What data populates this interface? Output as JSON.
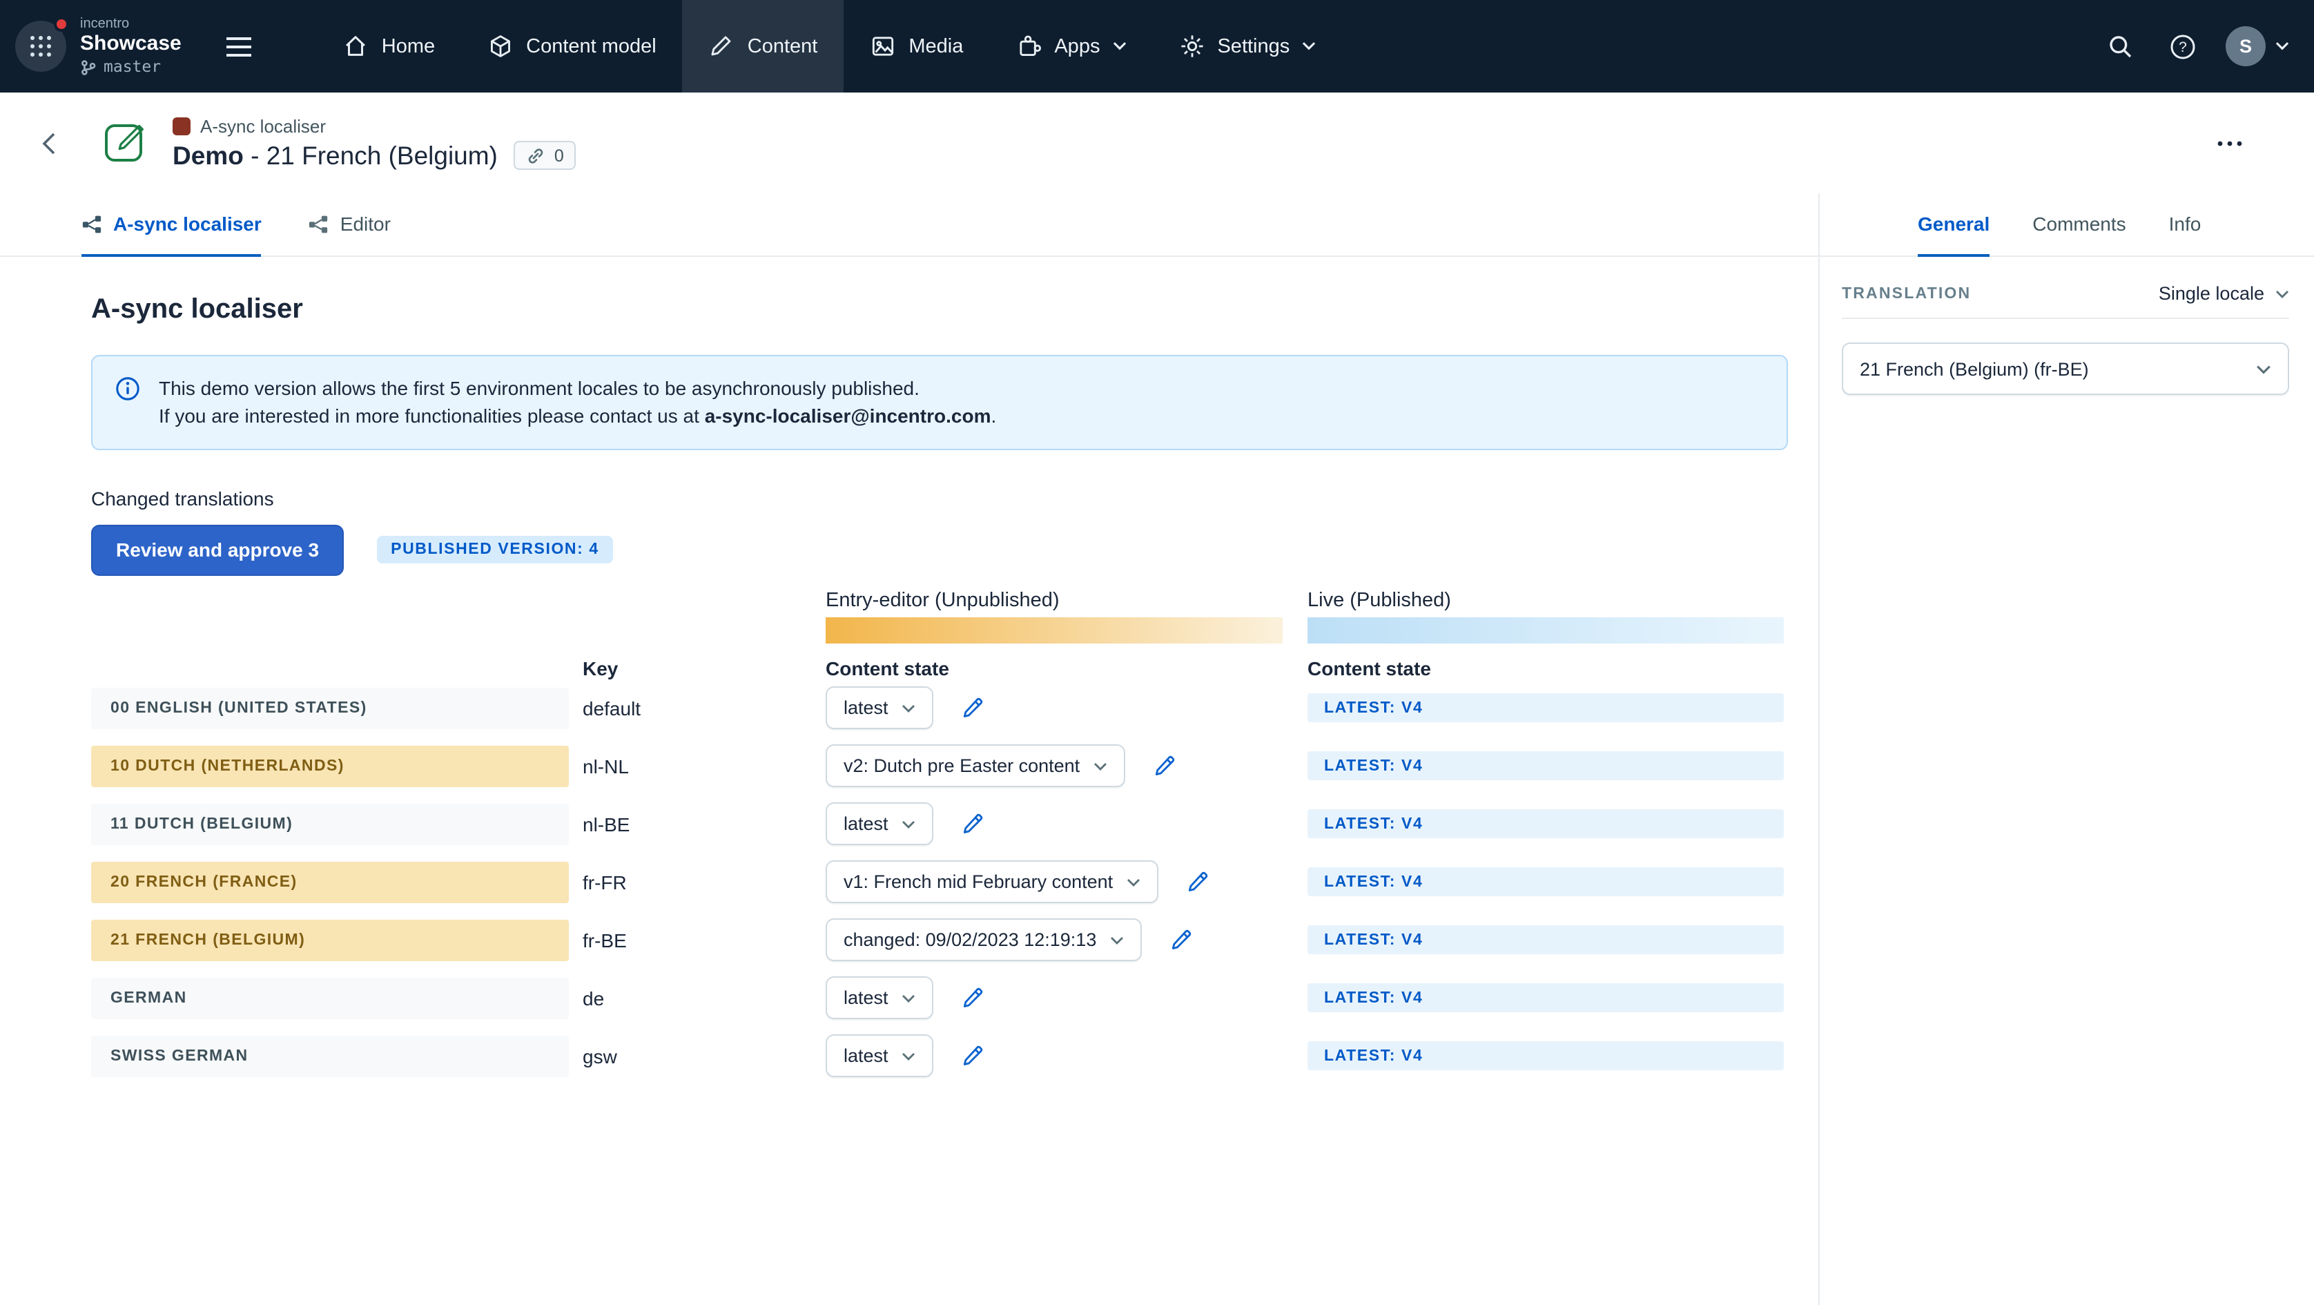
{
  "colors": {
    "nav_bg": "#0E1E2F",
    "accent_blue": "#0059C8",
    "button_blue": "#2D64C9",
    "warn_row_bg": "#F9E4B4",
    "note_bg": "#E8F5FF",
    "live_badge_bg": "#E7F3FC"
  },
  "topnav": {
    "org_label": "incentro",
    "space_name": "Showcase",
    "environment": "master",
    "items": [
      {
        "label": "Home"
      },
      {
        "label": "Content model"
      },
      {
        "label": "Content"
      },
      {
        "label": "Media"
      },
      {
        "label": "Apps"
      },
      {
        "label": "Settings"
      }
    ],
    "avatar_initial": "S"
  },
  "entry_header": {
    "breadcrumb": "A-sync localiser",
    "title_name": "Demo",
    "title_suffix": " - 21 French (Belgium)",
    "links_count": "0"
  },
  "tabs": {
    "async": "A-sync localiser",
    "editor": "Editor",
    "general": "General",
    "comments": "Comments",
    "info": "Info"
  },
  "main": {
    "heading": "A-sync localiser",
    "note": {
      "line1": "This demo version allows the first 5 environment locales to be asynchronously published.",
      "line2_prefix": "If you are interested in more functionalities please contact us at ",
      "email": "a-sync-localiser@incentro.com",
      "line2_suffix": "."
    },
    "changed_label": "Changed translations",
    "review_button": "Review and approve 3",
    "published_badge": "PUBLISHED VERSION: 4",
    "group_entry": "Entry-editor (Unpublished)",
    "group_live": "Live (Published)",
    "col_key": "Key",
    "col_state": "Content state",
    "rows": [
      {
        "locale": "00 ENGLISH (UNITED STATES)",
        "key": "default",
        "state": "latest",
        "live": "LATEST: V4"
      },
      {
        "locale": "10 DUTCH (NETHERLANDS)",
        "key": "nl-NL",
        "state": "v2: Dutch pre Easter content",
        "live": "LATEST: V4"
      },
      {
        "locale": "11 DUTCH (BELGIUM)",
        "key": "nl-BE",
        "state": "latest",
        "live": "LATEST: V4"
      },
      {
        "locale": "20 FRENCH (FRANCE)",
        "key": "fr-FR",
        "state": "v1: French mid February content",
        "live": "LATEST: V4"
      },
      {
        "locale": "21 FRENCH (BELGIUM)",
        "key": "fr-BE",
        "state": "changed: 09/02/2023 12:19:13",
        "live": "LATEST: V4"
      },
      {
        "locale": "GERMAN",
        "key": "de",
        "state": "latest",
        "live": "LATEST: V4"
      },
      {
        "locale": "SWISS GERMAN",
        "key": "gsw",
        "state": "latest",
        "live": "LATEST: V4"
      }
    ]
  },
  "sidebar": {
    "translation_label": "TRANSLATION",
    "mode_label": "Single locale",
    "locale_value": "21 French (Belgium) (fr-BE)"
  }
}
